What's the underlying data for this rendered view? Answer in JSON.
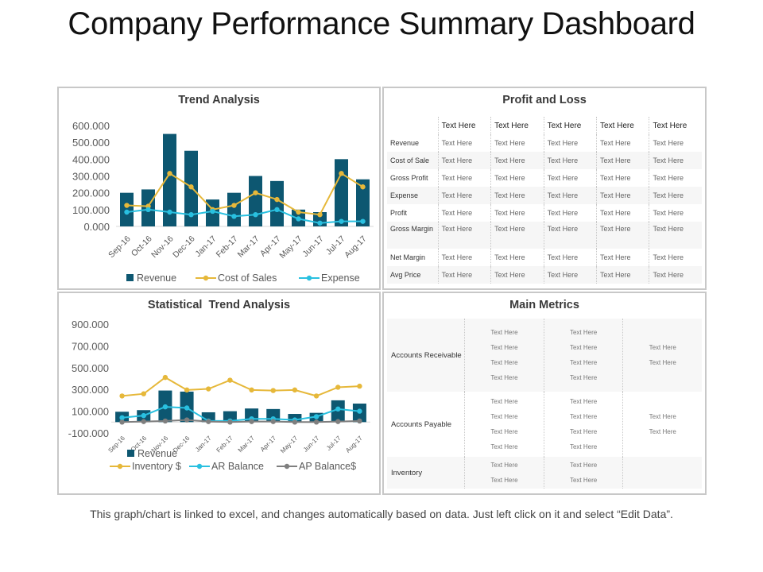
{
  "page": {
    "title": "Company Performance Summary Dashboard",
    "footer": "This graph/chart is linked to excel, and changes automatically  based on data. Just left click on it and select “Edit Data”."
  },
  "colors": {
    "revenue": "#0d5771",
    "cost_of_sales": "#e6b83a",
    "expense": "#29c0e0",
    "ap_balance": "#7f7f7f"
  },
  "chart_data": [
    {
      "type": "bar",
      "title": "Trend Analysis",
      "xlabel": "",
      "ylabel": "",
      "categories": [
        "Sep-16",
        "Oct-16",
        "Nov-16",
        "Dec-16",
        "Jan-17",
        "Feb-17",
        "Mar-17",
        "Apr-17",
        "May-17",
        "Jun-17",
        "Jul-17",
        "Aug-17"
      ],
      "yticks": [
        "600.000",
        "500.000",
        "400.000",
        "300.000",
        "200.000",
        "100.000",
        "0.000"
      ],
      "ylim": [
        0,
        600
      ],
      "grid": false,
      "legend": "bottom",
      "series": [
        {
          "name": "Revenue",
          "kind": "bar",
          "values": [
            200,
            220,
            550,
            450,
            160,
            200,
            300,
            270,
            100,
            85,
            400,
            280
          ]
        },
        {
          "name": "Cost of Sales",
          "kind": "line",
          "values": [
            125,
            120,
            315,
            235,
            100,
            125,
            200,
            160,
            85,
            70,
            315,
            235
          ]
        },
        {
          "name": "Expense",
          "kind": "line",
          "values": [
            85,
            100,
            85,
            70,
            90,
            60,
            70,
            100,
            45,
            20,
            30,
            30
          ]
        }
      ]
    },
    {
      "type": "bar",
      "title": "Statistical  Trend Analysis",
      "xlabel": "",
      "ylabel": "",
      "categories": [
        "Sep-16",
        "Oct-16",
        "Nov-16",
        "Dec-16",
        "Jan-17",
        "Feb-17",
        "Mar-17",
        "Apr-17",
        "May-17",
        "Jun-17",
        "Jul-17",
        "Aug-17"
      ],
      "yticks": [
        "900.000",
        "700.000",
        "500.000",
        "300.000",
        "100.000",
        "-100.000"
      ],
      "ylim": [
        -100,
        900
      ],
      "grid": false,
      "legend": "bottom",
      "series": [
        {
          "name": "Revenue",
          "kind": "bar",
          "values": [
            95,
            110,
            290,
            280,
            90,
            100,
            125,
            120,
            75,
            85,
            200,
            170
          ]
        },
        {
          "name": "Inventory $",
          "kind": "line",
          "values": [
            240,
            260,
            410,
            295,
            305,
            385,
            295,
            290,
            295,
            240,
            320,
            330
          ]
        },
        {
          "name": "AR Balance",
          "kind": "line",
          "values": [
            40,
            60,
            140,
            130,
            10,
            10,
            30,
            30,
            20,
            50,
            120,
            100
          ]
        },
        {
          "name": "AP Balance$",
          "kind": "line",
          "values": [
            0,
            5,
            10,
            20,
            5,
            0,
            5,
            5,
            0,
            0,
            5,
            10
          ]
        }
      ]
    }
  ],
  "profit_loss": {
    "title": "Profit and Loss",
    "headers": [
      "Text Here",
      "Text Here",
      "Text Here",
      "Text Here",
      "Text Here"
    ],
    "rows": [
      {
        "label": "Revenue",
        "cells": [
          "Text Here",
          "Text Here",
          "Text Here",
          "Text Here",
          "Text Here"
        ]
      },
      {
        "label": "Cost of Sale",
        "cells": [
          "Text Here",
          "Text Here",
          "Text Here",
          "Text Here",
          "Text Here"
        ]
      },
      {
        "label": "Gross Profit",
        "cells": [
          "Text Here",
          "Text Here",
          "Text Here",
          "Text Here",
          "Text Here"
        ]
      },
      {
        "label": "Expense",
        "cells": [
          "Text Here",
          "Text Here",
          "Text Here",
          "Text Here",
          "Text Here"
        ]
      },
      {
        "label": "Profit",
        "cells": [
          "Text Here",
          "Text Here",
          "Text Here",
          "Text Here",
          "Text Here"
        ]
      },
      {
        "label": "Gross Margin",
        "cells": [
          "Text Here",
          "Text Here",
          "Text Here",
          "Text Here",
          "Text Here"
        ]
      },
      {
        "label": "Net Margin",
        "cells": [
          "Text Here",
          "Text Here",
          "Text Here",
          "Text Here",
          "Text Here"
        ]
      },
      {
        "label": "Avg Price",
        "cells": [
          "Text Here",
          "Text Here",
          "Text Here",
          "Text Here",
          "Text Here"
        ]
      }
    ]
  },
  "main_metrics": {
    "title": "Main Metrics",
    "rows": [
      {
        "label": "Accounts Receivable",
        "col1": [
          "Text Here",
          "Text Here",
          "Text Here",
          "Text Here"
        ],
        "col2": [
          "Text Here",
          "Text Here",
          "Text Here",
          "Text Here"
        ],
        "col3": [
          "Text Here",
          "Text Here"
        ]
      },
      {
        "label": "Accounts Payable",
        "col1": [
          "Text Here",
          "Text Here",
          "Text Here",
          "Text Here"
        ],
        "col2": [
          "Text Here",
          "Text Here",
          "Text Here",
          "Text Here"
        ],
        "col3": [
          "Text Here",
          "Text Here"
        ]
      },
      {
        "label": "Inventory",
        "col1": [
          "Text Here",
          "Text Here"
        ],
        "col2": [
          "Text Here",
          "Text Here"
        ],
        "col3": []
      }
    ]
  }
}
